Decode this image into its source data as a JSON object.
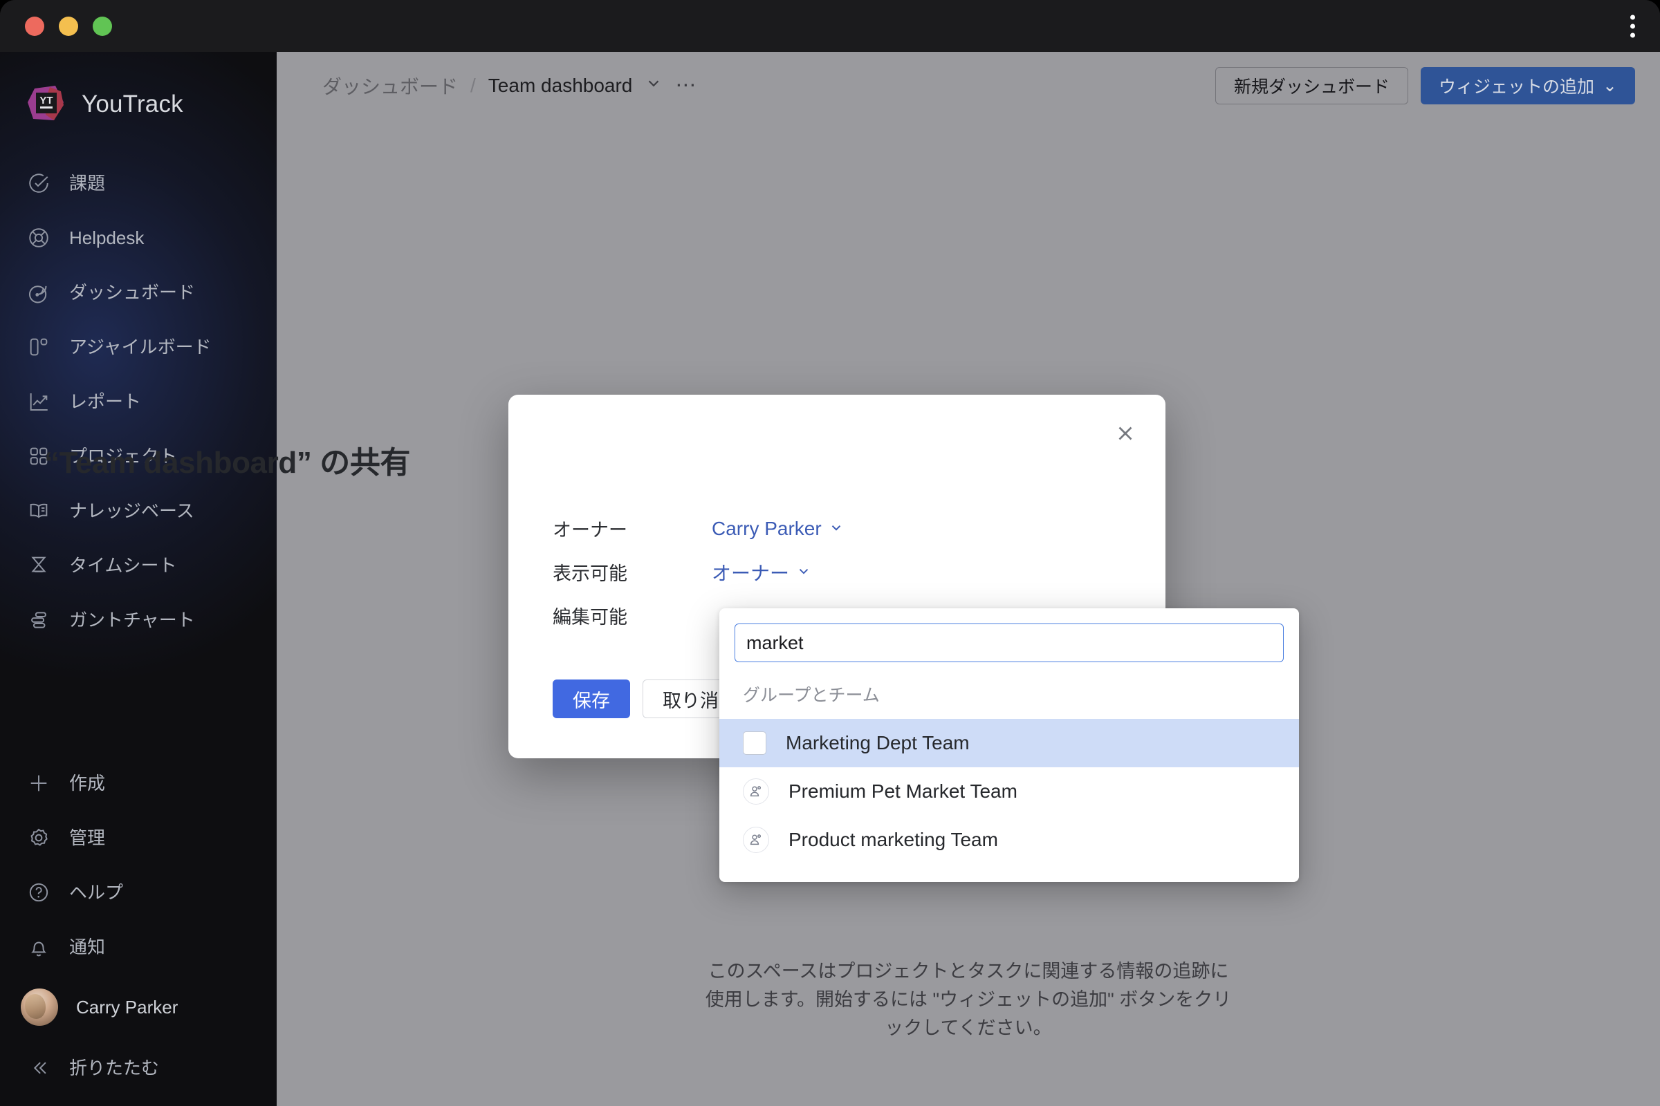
{
  "window": {
    "traffic_lights": [
      "close",
      "minimize",
      "zoom"
    ],
    "menu_icon": "kebab-menu-icon"
  },
  "sidebar": {
    "brand": "YouTrack",
    "logo_text": "YT",
    "items": [
      {
        "label": "課題",
        "icon": "check-circle-icon"
      },
      {
        "label": "Helpdesk",
        "icon": "lifebuoy-icon"
      },
      {
        "label": "ダッシュボード",
        "icon": "dashboard-icon"
      },
      {
        "label": "アジャイルボード",
        "icon": "agile-board-icon"
      },
      {
        "label": "レポート",
        "icon": "report-chart-icon"
      },
      {
        "label": "プロジェクト",
        "icon": "projects-grid-icon"
      },
      {
        "label": "ナレッジベース",
        "icon": "book-icon"
      },
      {
        "label": "タイムシート",
        "icon": "hourglass-icon"
      },
      {
        "label": "ガントチャート",
        "icon": "gantt-chart-icon"
      }
    ],
    "bottom_items": [
      {
        "label": "作成",
        "icon": "plus-icon"
      },
      {
        "label": "管理",
        "icon": "gear-icon"
      },
      {
        "label": "ヘルプ",
        "icon": "question-circle-icon"
      },
      {
        "label": "通知",
        "icon": "bell-icon"
      }
    ],
    "user": {
      "name": "Carry Parker",
      "avatar": "user-avatar"
    },
    "collapse": {
      "label": "折りたたむ",
      "icon": "chevron-double-left-icon"
    }
  },
  "topbar": {
    "breadcrumb": {
      "parent": "ダッシュボード",
      "separator": "/",
      "current": "Team dashboard",
      "chevron": "chevron-down-icon",
      "more": "⋯"
    },
    "new_dashboard_label": "新規ダッシュボード",
    "add_widget_label": "ウィジェットの追加",
    "add_widget_chevron": "⌄"
  },
  "empty_state": {
    "line1": "このスペースはプロジェクトとタスクに関連する情報の追跡に",
    "line2": "使用します。開始するには \"ウィジェットの追加\" ボタンをクリ",
    "line3": "ックしてください。"
  },
  "modal": {
    "title": "“Team dashboard” の共有",
    "close_icon": "close-icon",
    "rows": [
      {
        "label": "オーナー",
        "value": "Carry Parker",
        "chevron": "⌄"
      },
      {
        "label": "表示可能",
        "value": "オーナー",
        "chevron": "⌄"
      },
      {
        "label": "編集可能",
        "value": "",
        "chevron": ""
      }
    ],
    "save_label": "保存",
    "cancel_label": "取り消す"
  },
  "dropdown": {
    "search_value": "market",
    "search_placeholder": "",
    "group_title": "グループとチーム",
    "items": [
      {
        "label": "Marketing Dept Team",
        "selected": true,
        "icon": "checkbox-unchecked-icon"
      },
      {
        "label": "Premium Pet Market Team",
        "selected": false,
        "icon": "team-avatar-icon"
      },
      {
        "label": "Product marketing Team",
        "selected": false,
        "icon": "team-avatar-icon"
      }
    ]
  },
  "colors": {
    "accent_blue": "#4169e1",
    "link_blue": "#3b5bb5",
    "primary_button": "#2f5497",
    "selected_row": "#cedcf7",
    "sidebar_bg": "#0e0e11",
    "main_bg": "#9a9a9e"
  }
}
